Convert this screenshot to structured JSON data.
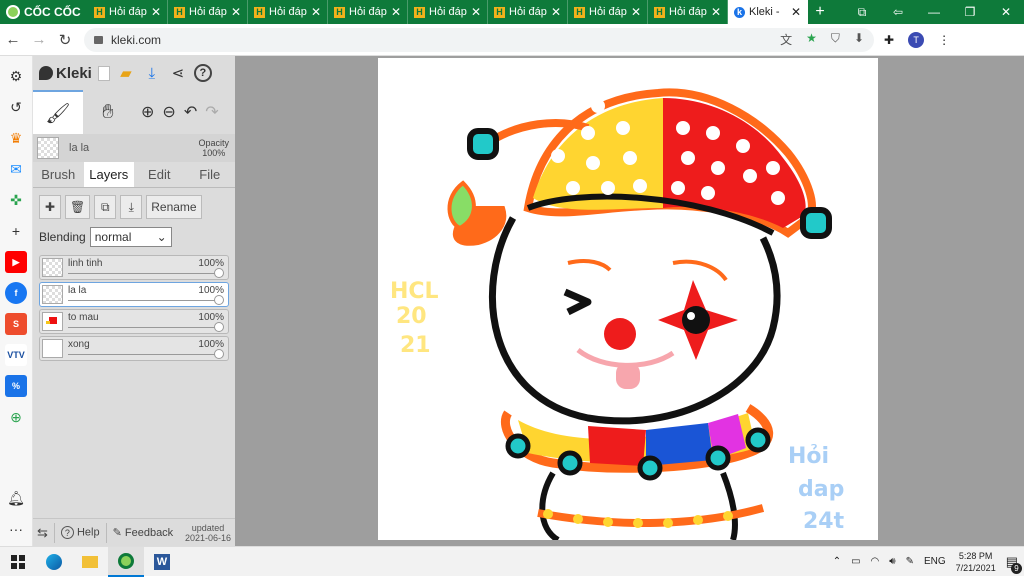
{
  "browser": {
    "brand": "CỐC CỐC",
    "tabs": [
      {
        "title": "Hỏi đáp"
      },
      {
        "title": "Hỏi đáp"
      },
      {
        "title": "Hỏi đáp"
      },
      {
        "title": "Hỏi đáp"
      },
      {
        "title": "Hỏi đáp"
      },
      {
        "title": "Hỏi đáp"
      },
      {
        "title": "Hỏi đáp"
      },
      {
        "title": "Hỏi đáp"
      }
    ],
    "active_tab": {
      "title": "Kleki - "
    },
    "url": "kleki.com",
    "profile_initial": "T"
  },
  "kleki": {
    "app_name": "Kleki",
    "current_layer_name": "la la",
    "opacity_label": "Opacity",
    "opacity_value": "100%",
    "tabs": [
      "Brush",
      "Layers",
      "Edit",
      "File"
    ],
    "active_tab": "Layers",
    "rename_label": "Rename",
    "blending_label": "Blending",
    "blending_value": "normal",
    "layers": [
      {
        "name": "linh tinh",
        "opacity": "100%",
        "selected": false
      },
      {
        "name": "la la",
        "opacity": "100%",
        "selected": true
      },
      {
        "name": "to mau",
        "opacity": "100%",
        "selected": false
      },
      {
        "name": "xong",
        "opacity": "100%",
        "selected": false
      }
    ],
    "footer": {
      "help": "Help",
      "feedback": "Feedback",
      "updated_label": "updated",
      "updated_date": "2021-06-16"
    }
  },
  "canvas": {
    "handwriting_left": [
      "HCL",
      "20",
      "21"
    ],
    "handwriting_right": [
      "Hỏi",
      "dap",
      "24t"
    ]
  },
  "taskbar": {
    "language": "ENG",
    "time": "5:28 PM",
    "date": "7/21/2021",
    "notification_count": "9"
  },
  "colors": {
    "browser_green": "#0e7a3a",
    "panel_bg": "#dcdcdc",
    "stage_bg": "#9e9e9e",
    "accent_blue": "#6ea5e0"
  }
}
